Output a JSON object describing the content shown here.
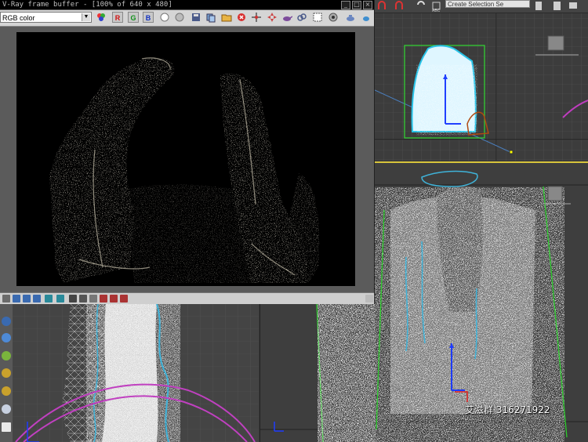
{
  "vfb": {
    "title": "V-Ray frame buffer - [100% of 640 x 480]",
    "channel": "RGB color",
    "channel_buttons": [
      "R",
      "G",
      "B"
    ],
    "window_controls": [
      "_",
      "□",
      "×"
    ]
  },
  "top_toolbar": {
    "selection_set_placeholder": "Create Selection Se"
  },
  "watermark": "艾滋群 316271922",
  "colors": {
    "vfb_background": "#5b5b5b",
    "toolbar": "#d5d5d5",
    "viewport_bg": "#3c3c3c",
    "active_viewport_border": "#d7c33b",
    "selection_box": "#2ecc2e",
    "gizmo_blue": "#1e3cff",
    "gizmo_red": "#e02020",
    "spline_cyan": "#3fb3d9",
    "spline_magenta": "#c040c0"
  },
  "icons": {
    "vfb_toolbar": [
      "color-picker-icon",
      "white-circle-icon",
      "gray-circle-icon",
      "save-icon",
      "copy-icon",
      "history-icon",
      "clear-icon",
      "stop-render-icon",
      "link-icon",
      "lens-fx-icon",
      "region-icon",
      "track-mouse-icon",
      "compare-icon",
      "teapot-icon"
    ],
    "vfb_bottom": [
      "levels-icon",
      "curves-icon",
      "exposure-icon",
      "histogram-icon",
      "lut-icon",
      "ocio-icon",
      "icc-icon",
      "linear-icon",
      "srgb-icon",
      "zoom-icon",
      "pan-icon",
      "crosshair-icon"
    ],
    "side_tools": [
      "arrow-icon",
      "snowflake-icon",
      "leaf-icon",
      "gold-orb-icon",
      "sphere-icon",
      "grid-icon"
    ]
  }
}
